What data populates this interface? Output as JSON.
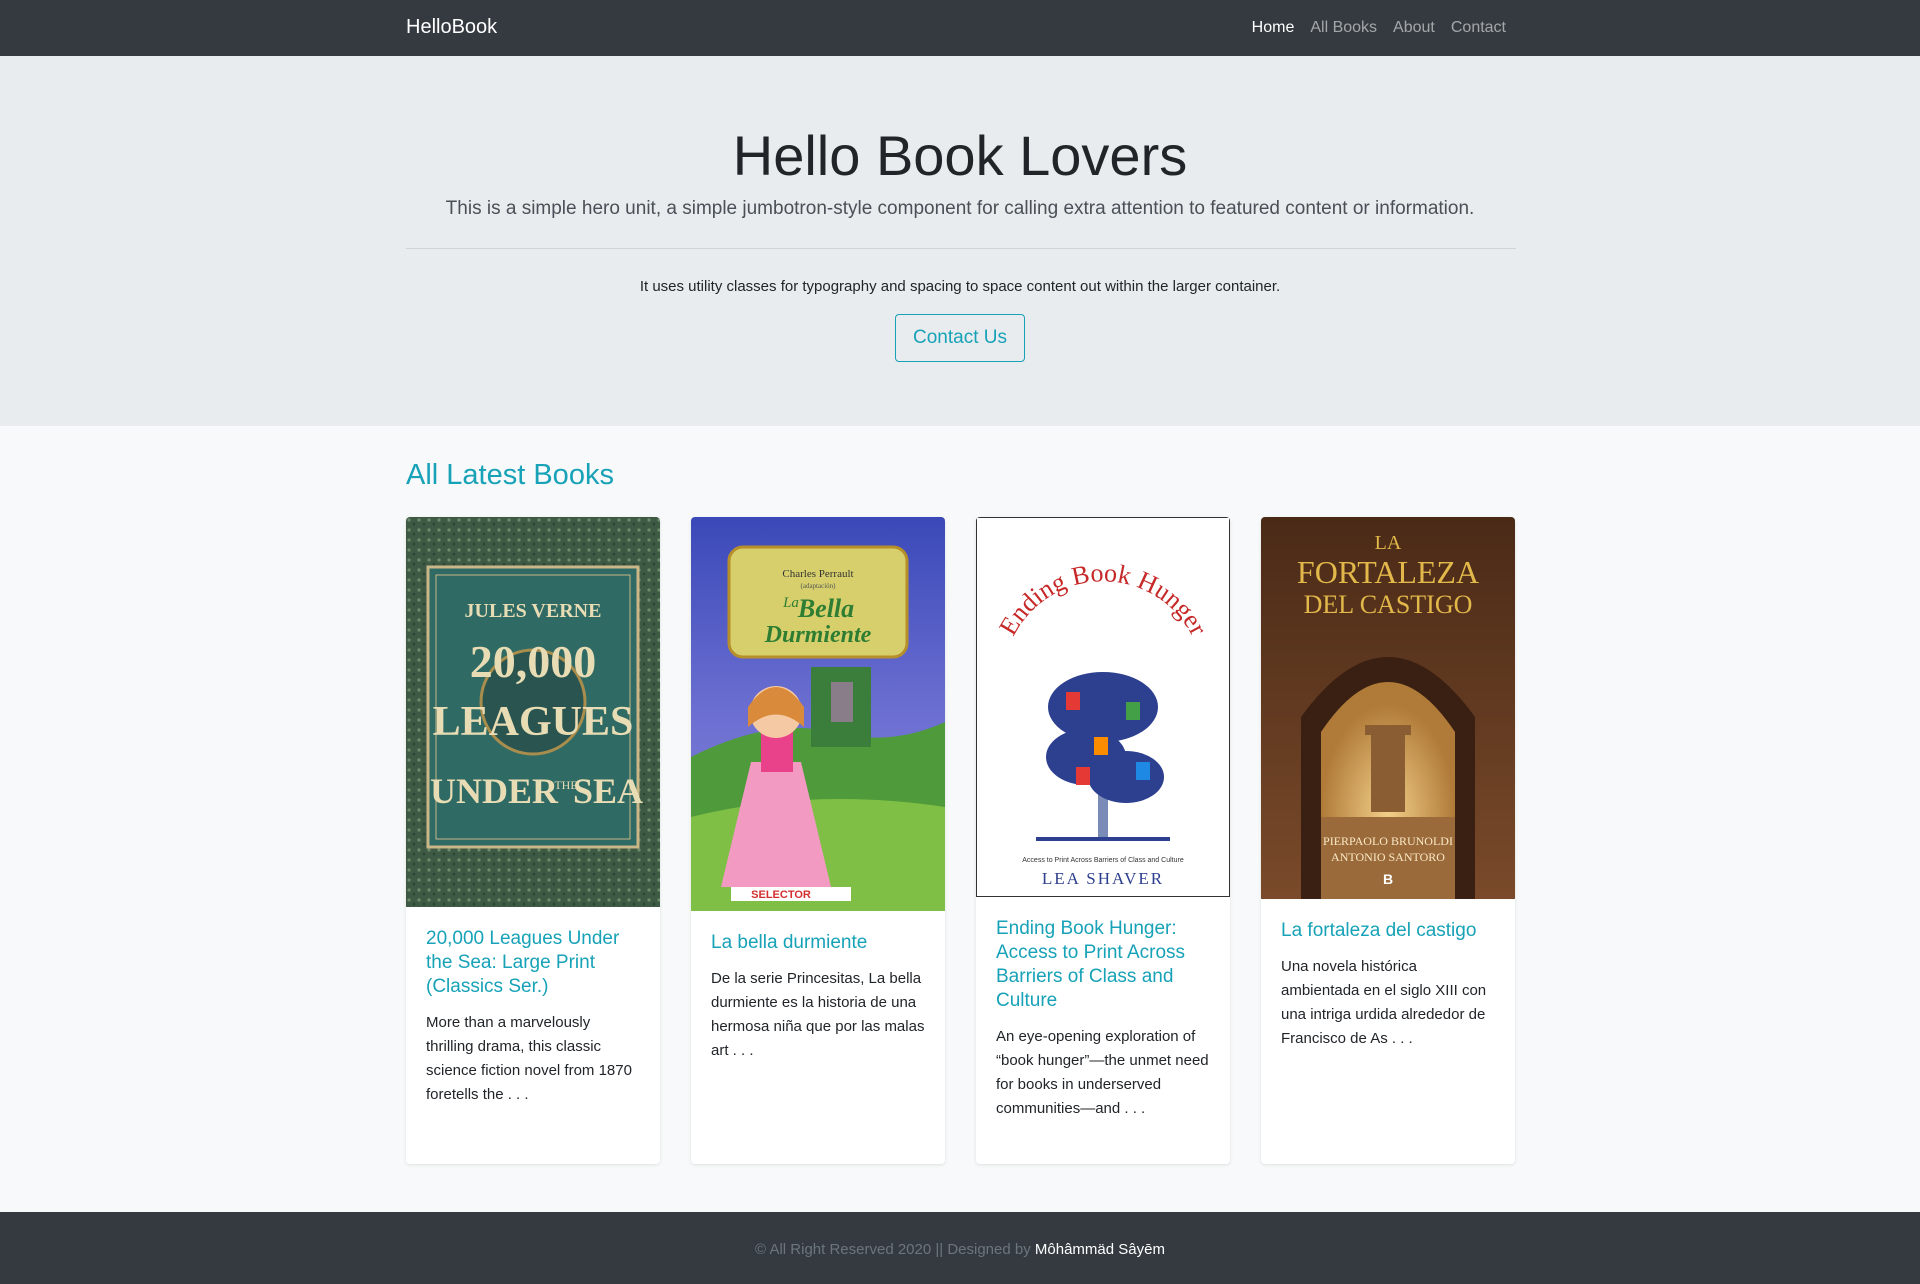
{
  "navbar": {
    "brand": "HelloBook",
    "links": [
      {
        "label": "Home",
        "active": true
      },
      {
        "label": "All Books",
        "active": false
      },
      {
        "label": "About",
        "active": false
      },
      {
        "label": "Contact",
        "active": false
      }
    ]
  },
  "hero": {
    "title": "Hello Book Lovers",
    "lead": "This is a simple hero unit, a simple jumbotron-style component for calling extra attention to featured content or information.",
    "text": "It uses utility classes for typography and spacing to space content out within the larger container.",
    "button_label": "Contact Us"
  },
  "section": {
    "title": "All Latest Books"
  },
  "books": [
    {
      "title": "20,000 Leagues Under the Sea: Large Print (Classics Ser.)",
      "description": "More than a marvelously thrilling drama, this classic science fiction novel from 1870 foretells the . . .",
      "cover": {
        "author": "JULES VERNE",
        "line1": "20,000",
        "line2": "LEAGUES",
        "line3": "UNDER",
        "small": "THE",
        "line4": "SEA"
      }
    },
    {
      "title": "La bella durmiente",
      "description": "De la serie Princesitas, La bella durmiente es la historia de una hermosa niña que por las malas art . . .",
      "cover": {
        "author": "Charles Perrault",
        "note": "(adaptación)",
        "title1": "La",
        "title2": "Bella",
        "title3": "Durmiente",
        "publisher": "SELECTOR"
      }
    },
    {
      "title": "Ending Book Hunger: Access to Print Across Barriers of Class and Culture",
      "description": "An eye-opening exploration of “book hunger”—the unmet need for books in underserved communities—and . . .",
      "cover": {
        "title": "Ending Book Hunger",
        "subtitle": "Access to Print Across Barriers of Class and Culture",
        "author": "LEA SHAVER"
      }
    },
    {
      "title": "La fortaleza del castigo",
      "description": "Una novela histórica ambientada en el siglo XIII con una intriga urdida alrededor de Francisco de As . . .",
      "cover": {
        "title1": "LA",
        "title2": "FORTALEZA",
        "title3": "DEL CASTIGO",
        "author1": "PIERPAOLO BRUNOLDI",
        "author2": "ANTONIO SANTORO",
        "publisher": "B"
      }
    }
  ],
  "footer": {
    "text": "© All Right Reserved 2020 || Designed by",
    "designer": "Môhâmmäd Sâyēm"
  },
  "colors": {
    "accent": "#17a2b8",
    "navbar": "#343a40",
    "jumbotron": "#e9ecef"
  }
}
